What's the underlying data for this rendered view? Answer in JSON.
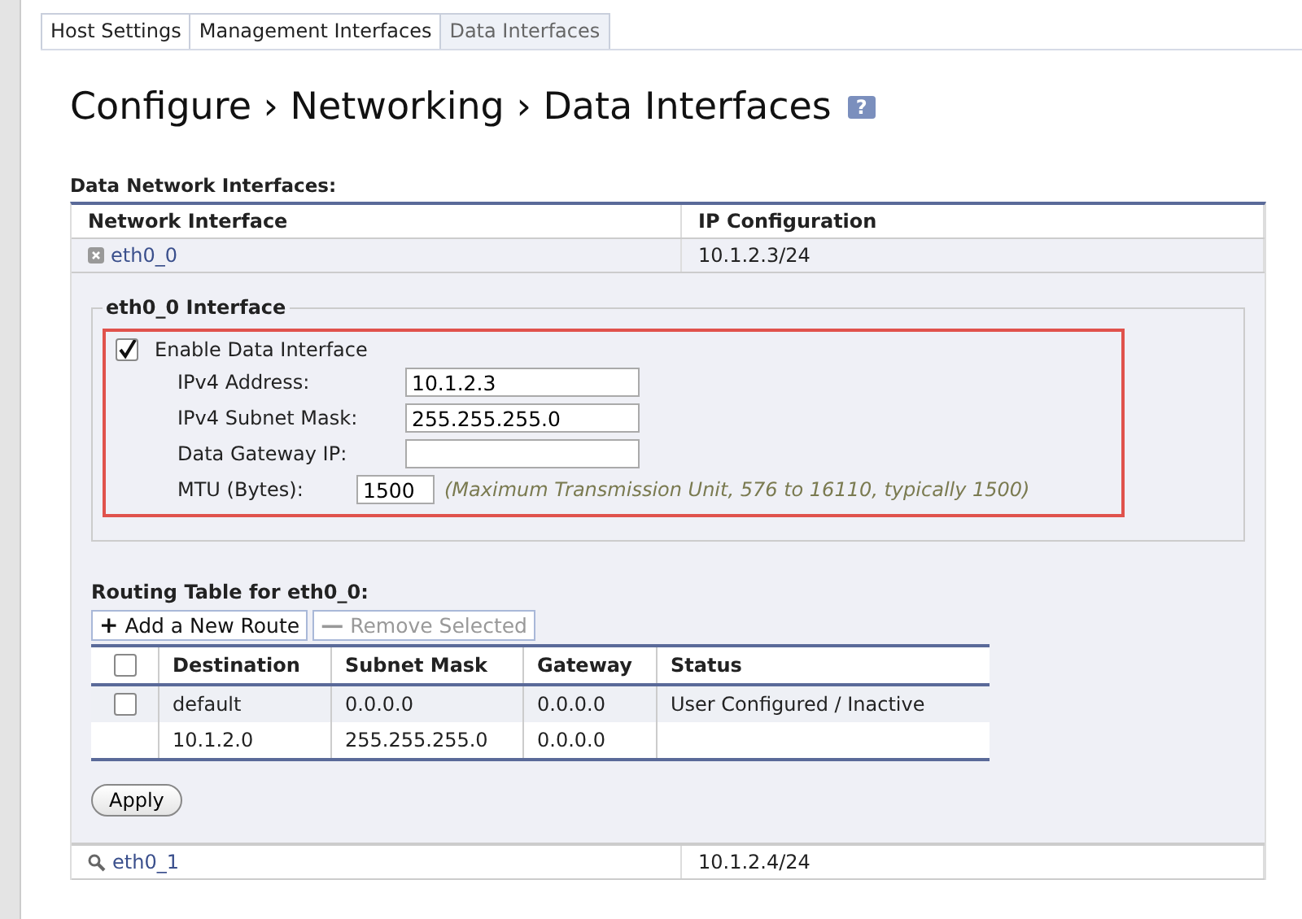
{
  "tabs": [
    {
      "label": "Host Settings",
      "selected": false
    },
    {
      "label": "Management Interfaces",
      "selected": false
    },
    {
      "label": "Data Interfaces",
      "selected": true
    }
  ],
  "title": "Configure › Networking › Data Interfaces",
  "help_icon": "?",
  "section_title": "Data Network Interfaces:",
  "columns": [
    "Network Interface",
    "IP Configuration"
  ],
  "interfaces": [
    {
      "name": "eth0_0",
      "ip": "10.1.2.3/24",
      "expanded": true,
      "panel": {
        "legend": "eth0_0 Interface",
        "enable": {
          "label": "Enable Data Interface",
          "checked": true
        },
        "fields": [
          {
            "label": "IPv4 Address:",
            "value": "10.1.2.3"
          },
          {
            "label": "IPv4 Subnet Mask:",
            "value": "255.255.255.0"
          },
          {
            "label": "Data Gateway IP:"
          }
        ],
        "mtu": {
          "label": "MTU (Bytes):",
          "value": "1500",
          "hint": "(Maximum Transmission Unit, 576 to 16110, typically 1500)"
        },
        "routing_title": "Routing Table for eth0_0:",
        "buttons": [
          {
            "icon": "+",
            "label": "Add a New Route",
            "disabled": false
          },
          {
            "icon": "—",
            "label": "Remove Selected",
            "disabled": true
          }
        ],
        "route_columns": [
          "Destination",
          "Subnet Mask",
          "Gateway",
          "Status"
        ],
        "header_checkbox": {
          "checked": false
        },
        "routes": [
          {
            "checkbox": {
              "checked": false
            },
            "cells": [
              "default",
              "0.0.0.0",
              "0.0.0.0",
              "User Configured / Inactive"
            ]
          },
          {
            "cells": [
              "10.1.2.0",
              "255.255.255.0",
              "0.0.0.0",
              ""
            ]
          }
        ],
        "apply": "Apply"
      }
    },
    {
      "name": "eth0_1",
      "ip": "10.1.2.4/24",
      "expanded": false
    }
  ]
}
